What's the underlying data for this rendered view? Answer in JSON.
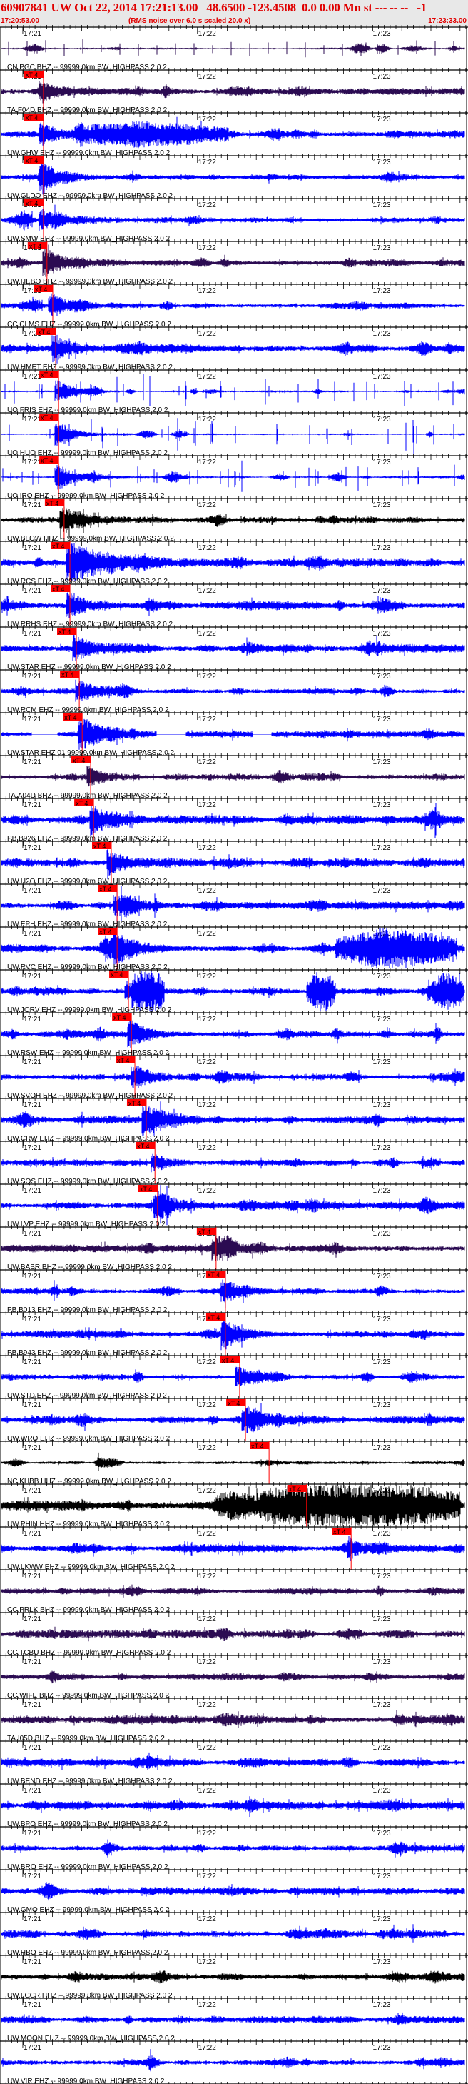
{
  "header": {
    "title": "60907841 UW Oct 22, 2014 17:21:13.00   48.6500 -123.4508  0.0 0.00 Mn st --- -- --   -1",
    "start_time": "17:20:53.00",
    "note": "(RMS noise over 6.0 s scaled 20.0 x)",
    "end_time": "17:23:33.00"
  },
  "colors": {
    "header_text": "#e00000",
    "pick": "#ff0000",
    "blue": "#0000ff",
    "purple": "#2b0b52",
    "black": "#000000"
  },
  "pick_label": "xT 4",
  "chart_data": {
    "type": "line",
    "title": "Seismogram record section, event 60907841",
    "x_axis": {
      "start": "17:20:53.00",
      "end": "17:23:33.00",
      "duration_s": 160,
      "tick_labels": [
        "17:21",
        "17:22",
        "17:23"
      ],
      "tick_offsets_s": [
        7,
        67,
        127
      ]
    },
    "top_trace": {
      "color": "purple"
    },
    "traces": [
      {
        "label": "CN.PGC BHZ -- 99999.0km BW_HIGHPASS 2.0 2",
        "color": "purple",
        "pick_s": 14.1
      },
      {
        "label": "TA.F04D BHZ -- 99999.0km BW_HIGHPASS 2.0 2",
        "color": "blue",
        "pick_s": 14.1
      },
      {
        "label": "UW.GHW EHZ -- 99999.0km BW_HIGHPASS 2.0 2",
        "color": "blue",
        "pick_s": 14.1
      },
      {
        "label": "UW.GLDO EHZ -- 99999.0km BW_HIGHPASS 2.0 2",
        "color": "blue",
        "pick_s": 14.1
      },
      {
        "label": "UW.SMW EHZ -- 99999.0km BW_HIGHPASS 2.0 2",
        "color": "purple",
        "pick_s": 15.3
      },
      {
        "label": "UW.HEBO BHZ -- 99999.0km BW_HIGHPASS 2.0 2",
        "color": "blue",
        "pick_s": 17.3
      },
      {
        "label": "CC.CLMS EHZ -- 99999.0km BW_HIGHPASS 2.0 2",
        "color": "blue",
        "pick_s": 18.3
      },
      {
        "label": "UW.HMET EHZ -- 99999.0km BW_HIGHPASS 2.0 2",
        "color": "blue",
        "pick_s": 19.3
      },
      {
        "label": "UO.FRIS EHZ -- 99999.0km BW_HIGHPASS 2.0 2",
        "color": "blue",
        "pick_s": 19.3
      },
      {
        "label": "UO.HUO EHZ -- 99999.0km BW_HIGHPASS 2.0 2",
        "color": "blue",
        "pick_s": 19.3
      },
      {
        "label": "UO.IRO EHZ -- 99999.0km BW_HIGHPASS 2.0 2",
        "color": "black",
        "pick_s": 21.2
      },
      {
        "label": "UW.BLOW HHZ -- 99999.0km BW_HIGHPASS 2.0 2",
        "color": "blue",
        "pick_s": 23.2
      },
      {
        "label": "UW.RCS EHZ -- 99999.0km BW_HIGHPASS 2.0 2",
        "color": "blue",
        "pick_s": 23.2
      },
      {
        "label": "UW.RRHS EHZ -- 99999.0km BW_HIGHPASS 2.0 2",
        "color": "blue",
        "pick_s": 25.4
      },
      {
        "label": "UW.STAR EHZ -- 99999.0km BW_HIGHPASS 2.0 2",
        "color": "blue",
        "pick_s": 26.4
      },
      {
        "label": "UW.RCM EHZ -- 99999.0km BW_HIGHPASS 2.0 2",
        "color": "blue",
        "pick_s": 27.4
      },
      {
        "label": "UW.STAR EHZ 01 99999.0km BW_HIGHPASS 2.0 2",
        "color": "purple",
        "pick_s": 30.3
      },
      {
        "label": "TA.A04D BHZ -- 99999.0km BW_HIGHPASS 2.0 2",
        "color": "blue",
        "pick_s": 31.3
      },
      {
        "label": "PB.B926 EHZ -- 99999.0km BW_HIGHPASS 2.0 2",
        "color": "blue",
        "pick_s": 37.4
      },
      {
        "label": "UW.H2O EHZ -- 99999.0km BW_HIGHPASS 2.0 2",
        "color": "blue",
        "pick_s": 39.4
      },
      {
        "label": "UW.EPH EHZ -- 99999.0km BW_HIGHPASS 2.0 2",
        "color": "blue",
        "pick_s": 39.4
      },
      {
        "label": "UW.RVC EHZ -- 99999.0km BW_HIGHPASS 2.0 2",
        "color": "blue",
        "pick_s": 43.3
      },
      {
        "label": "UW.JORV EHZ -- 99999.0km BW_HIGHPASS 2.0 2",
        "color": "blue",
        "pick_s": 44.3
      },
      {
        "label": "UW.RSW EHZ -- 99999.0km BW_HIGHPASS 2.0 2",
        "color": "blue",
        "pick_s": 45.5
      },
      {
        "label": "UW.SVOH EHZ -- 99999.0km BW_HIGHPASS 2.0 2",
        "color": "blue",
        "pick_s": 49.4
      },
      {
        "label": "UW.CRW EHZ -- 99999.0km BW_HIGHPASS 2.0 2",
        "color": "blue",
        "pick_s": 52.4
      },
      {
        "label": "UW.SQS EHZ -- 99999.0km BW_HIGHPASS 2.0 2",
        "color": "blue",
        "pick_s": 53.3
      },
      {
        "label": "UW.LVP EHZ -- 99999.0km BW_HIGHPASS 2.0 2",
        "color": "purple",
        "pick_s": 73.4
      },
      {
        "label": "UW.BABR BHZ -- 99999.0km BW_HIGHPASS 2.0 2",
        "color": "blue",
        "pick_s": 76.6
      },
      {
        "label": "PB.B013 EHZ -- 99999.0km BW_HIGHPASS 2.0 2",
        "color": "blue",
        "pick_s": 76.6
      },
      {
        "label": "PB.B943 EHZ -- 99999.0km BW_HIGHPASS 2.0 2",
        "color": "blue",
        "pick_s": 81.5
      },
      {
        "label": "UW.STD EHZ -- 99999.0km BW_HIGHPASS 2.0 2",
        "color": "blue",
        "pick_s": 83.5
      },
      {
        "label": "UW.WRO EHZ -- 99999.0km BW_HIGHPASS 2.0 2",
        "color": "black",
        "pick_s": 91.6
      },
      {
        "label": "NC.KHBB HHZ -- 99999.0km BW_HIGHPASS 2.0 2",
        "color": "black",
        "pick_s": 104.5
      },
      {
        "label": "UW.PHIN HHZ -- 99999.0km BW_HIGHPASS 2.0 2",
        "color": "blue",
        "pick_s": 119.8
      },
      {
        "label": "UW.LKWW EHZ -- 99999.0km BW_HIGHPASS 2.0 2",
        "color": "purple",
        "pick_s": null
      },
      {
        "label": "CC.PRLK BHZ -- 99999.0km BW_HIGHPASS 2.0 2",
        "color": "purple",
        "pick_s": null
      },
      {
        "label": "CC.TCBU BHZ -- 99999.0km BW_HIGHPASS 2.0 2",
        "color": "purple",
        "pick_s": null
      },
      {
        "label": "CC.WIFE BHZ -- 99999.0km BW_HIGHPASS 2.0 2",
        "color": "purple",
        "pick_s": null
      },
      {
        "label": "TA.I05D BHZ -- 99999.0km BW_HIGHPASS 2.0 2",
        "color": "blue",
        "pick_s": null
      },
      {
        "label": "UW.BEND EHZ -- 99999.0km BW_HIGHPASS 2.0 2",
        "color": "blue",
        "pick_s": null
      },
      {
        "label": "UW.BPO EHZ -- 99999.0km BW_HIGHPASS 2.0 2",
        "color": "blue",
        "pick_s": null
      },
      {
        "label": "UW.BRO EHZ -- 99999.0km BW_HIGHPASS 2.0 2",
        "color": "blue",
        "pick_s": null
      },
      {
        "label": "UW.GMO EHZ -- 99999.0km BW_HIGHPASS 2.0 2",
        "color": "blue",
        "pick_s": null
      },
      {
        "label": "UW.HBO EHZ -- 99999.0km BW_HIGHPASS 2.0 2",
        "color": "black",
        "pick_s": null
      },
      {
        "label": "UW.LCCR HHZ -- 99999.0km BW_HIGHPASS 2.0 2",
        "color": "blue",
        "pick_s": null
      },
      {
        "label": "UW.MOON EHZ -- 99999.0km BW_HIGHPASS 2.0 2",
        "color": "blue",
        "pick_s": null
      },
      {
        "label": "UW.VIR EHZ -- 99999.0km BW_HIGHPASS 2.0 2",
        "color": "blue",
        "pick_s": null
      }
    ]
  }
}
